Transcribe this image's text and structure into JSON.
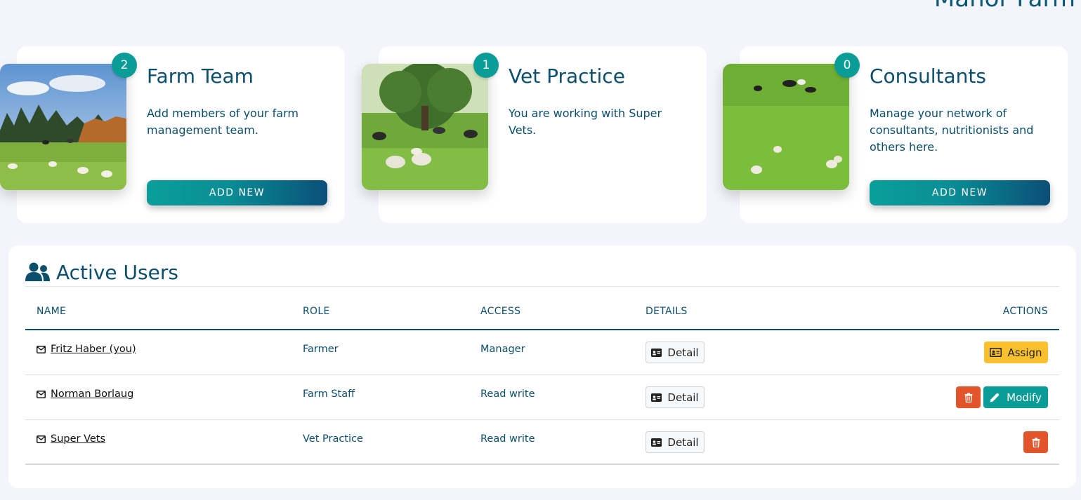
{
  "page": {
    "title": "Manor Farm"
  },
  "cards": [
    {
      "badge": "2",
      "title": "Farm Team",
      "description": "Add members of your farm management team.",
      "button": "ADD NEW"
    },
    {
      "badge": "1",
      "title": "Vet Practice",
      "description": "You are working with Super Vets."
    },
    {
      "badge": "0",
      "title": "Consultants",
      "description": "Manage your network of consultants, nutritionists and others here.",
      "button": "ADD NEW"
    }
  ],
  "users": {
    "title": "Active Users",
    "columns": {
      "name": "NAME",
      "role": "ROLE",
      "access": "ACCESS",
      "details": "DETAILS",
      "actions": "ACTIONS"
    },
    "rows": [
      {
        "name": "Fritz Haber (you)",
        "role": "Farmer",
        "access": "Manager",
        "detail": "Detail",
        "assign": "Assign"
      },
      {
        "name": "Norman Borlaug",
        "role": "Farm Staff",
        "access": "Read write",
        "detail": "Detail",
        "modify": "Modify"
      },
      {
        "name": "Super Vets",
        "role": "Vet Practice",
        "access": "Read write",
        "detail": "Detail"
      }
    ]
  },
  "colors": {
    "primary": "#0b4f6c",
    "teal": "#0a9c96",
    "warning": "#fbc02d",
    "danger": "#e2552b",
    "background": "#f4f5fc"
  },
  "icons": [
    "users-icon",
    "mail-icon",
    "id-card-icon",
    "trash-icon",
    "pencil-icon"
  ]
}
